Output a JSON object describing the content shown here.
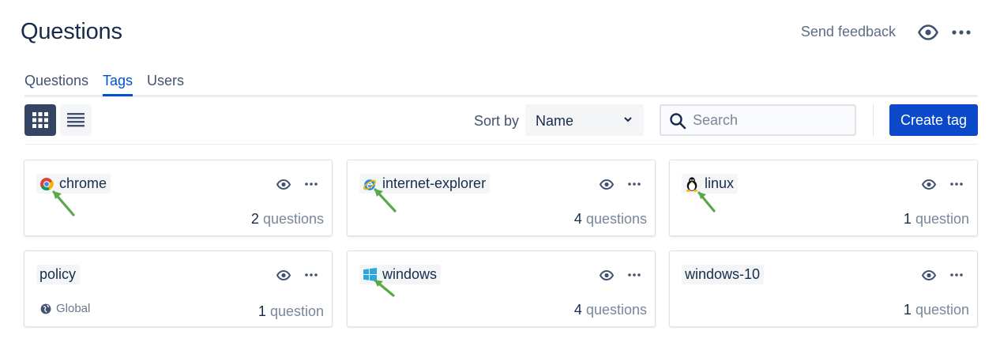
{
  "header": {
    "title": "Questions",
    "feedback_label": "Send feedback",
    "watch_icon": "eye-icon",
    "more_icon": "more-horizontal-icon"
  },
  "tabs": [
    {
      "label": "Questions",
      "active": false
    },
    {
      "label": "Tags",
      "active": true
    },
    {
      "label": "Users",
      "active": false
    }
  ],
  "toolbar": {
    "grid_view_icon": "grid-view-icon",
    "list_view_icon": "list-view-icon",
    "sort_label": "Sort by",
    "sort_value": "Name",
    "search_placeholder": "Search",
    "create_label": "Create tag"
  },
  "colors": {
    "accent": "#0052cc",
    "create_button": "#0c49c9",
    "annotation_arrow": "#5aa84a"
  },
  "tags": [
    {
      "name": "chrome",
      "icon": "chrome-icon",
      "count": "2",
      "count_label": "questions",
      "scope": ""
    },
    {
      "name": "internet-explorer",
      "icon": "internet-explorer-icon",
      "count": "4",
      "count_label": "questions",
      "scope": ""
    },
    {
      "name": "linux",
      "icon": "linux-tux-icon",
      "count": "1",
      "count_label": "question",
      "scope": ""
    },
    {
      "name": "policy",
      "icon": "",
      "count": "1",
      "count_label": "question",
      "scope": "Global"
    },
    {
      "name": "windows",
      "icon": "windows-icon",
      "count": "4",
      "count_label": "questions",
      "scope": ""
    },
    {
      "name": "windows-10",
      "icon": "",
      "count": "1",
      "count_label": "question",
      "scope": ""
    }
  ]
}
